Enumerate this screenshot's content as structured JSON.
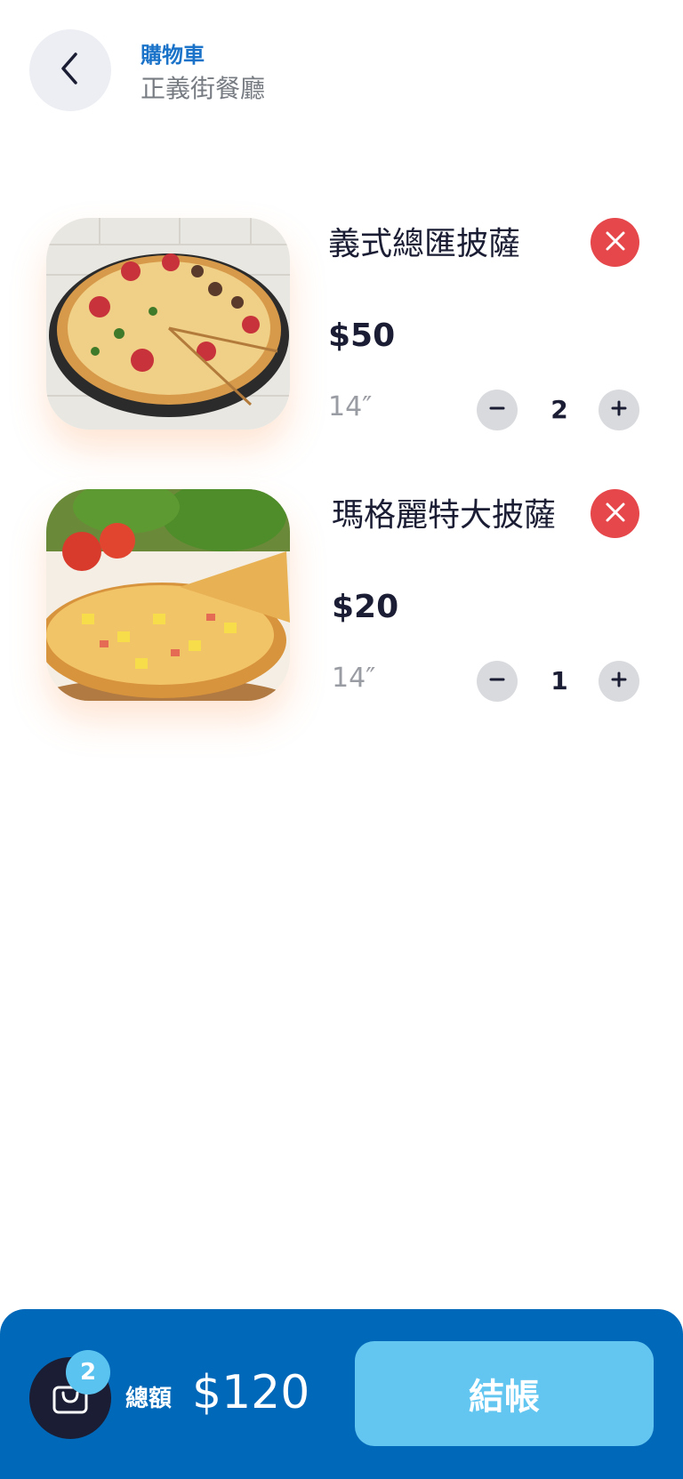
{
  "header": {
    "title": "購物車",
    "subtitle": "正義街餐廳",
    "back_icon": "chevron-left-icon"
  },
  "cart_items": [
    {
      "name": "義式總匯披薩",
      "price": "$50",
      "size": "14″",
      "quantity": "2",
      "image": "pizza-supreme-image"
    },
    {
      "name": "瑪格麗特大披薩",
      "price": "$20",
      "size": "14″",
      "quantity": "1",
      "image": "pizza-hawaiian-image"
    }
  ],
  "footer": {
    "bag_count": "2",
    "total_label": "總額",
    "total_value": "$120",
    "checkout_label": "結帳"
  },
  "colors": {
    "primary": "#0068b8",
    "accent": "#62c6f1",
    "danger": "#e5474b",
    "title_blue": "#1a73c8"
  }
}
